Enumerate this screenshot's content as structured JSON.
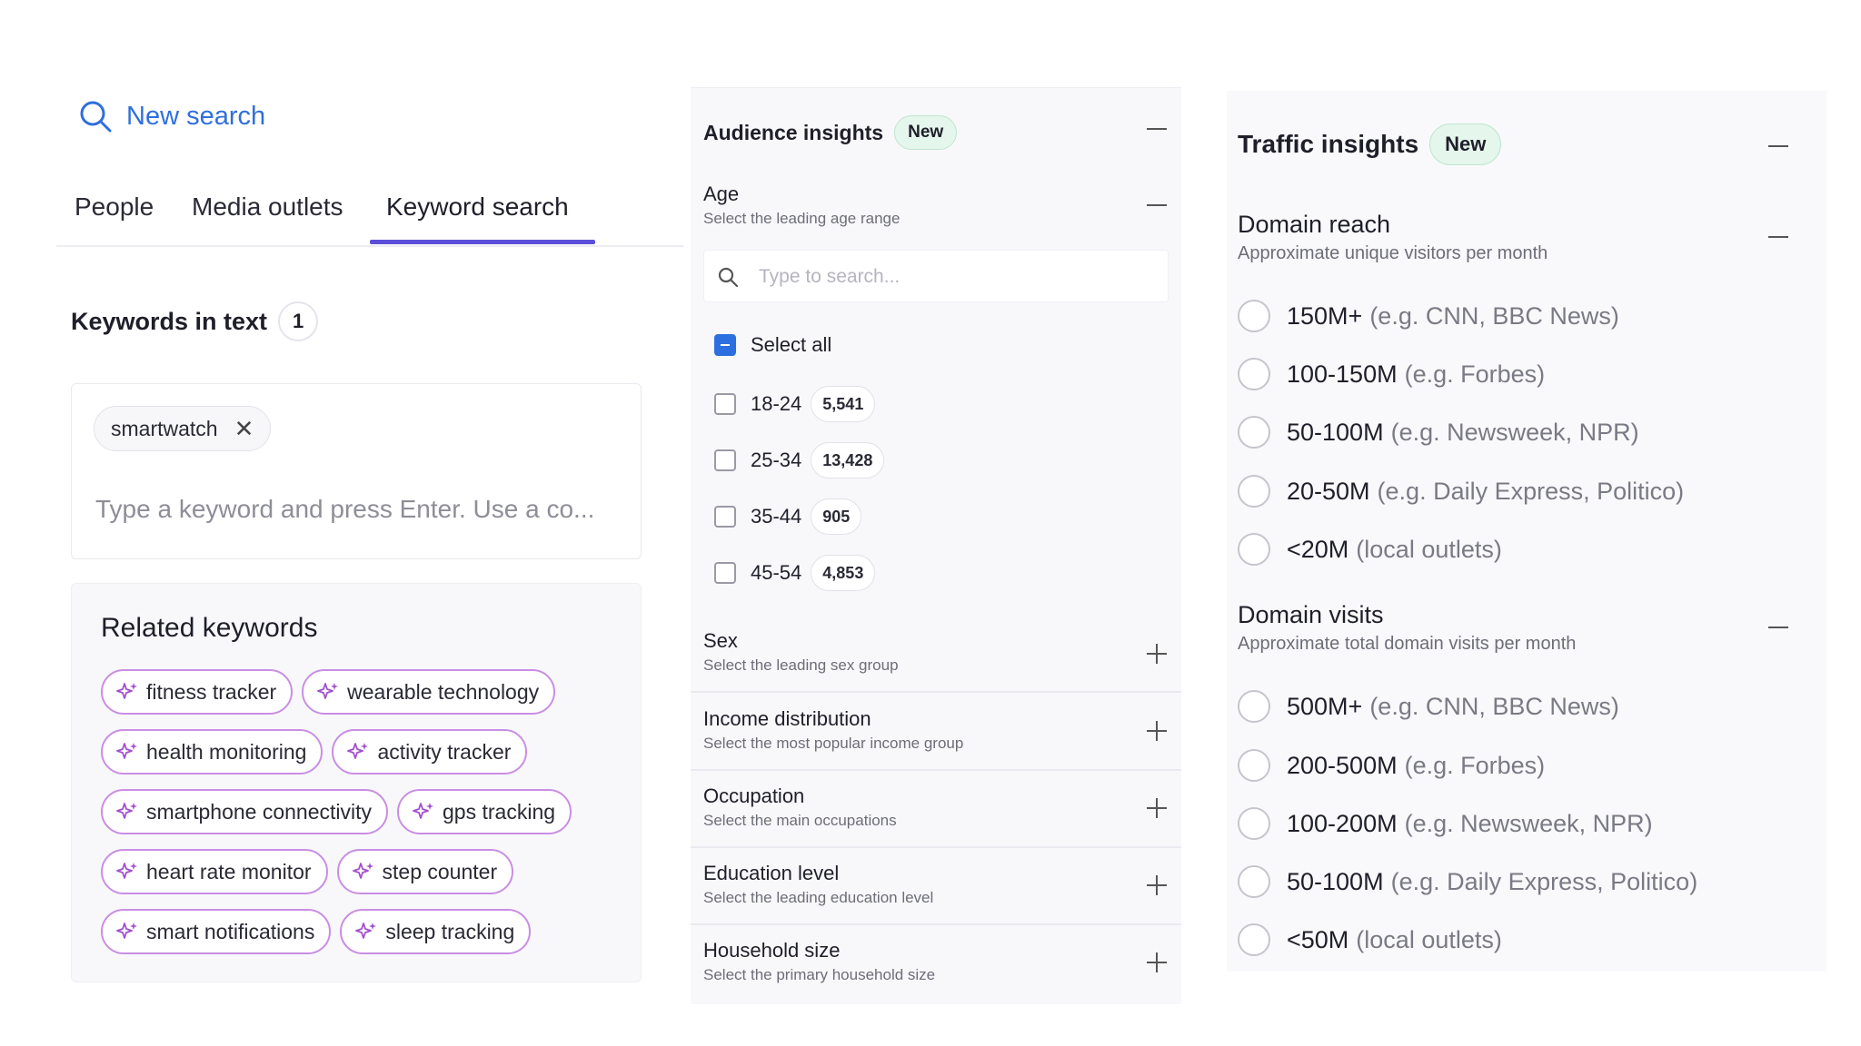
{
  "search": {
    "new_search_label": "New search",
    "tabs": [
      {
        "label": "People"
      },
      {
        "label": "Media outlets"
      },
      {
        "label": "Keyword search"
      }
    ],
    "active_tab": "Keyword search"
  },
  "keywords": {
    "title": "Keywords in text",
    "count": "1",
    "chips": [
      {
        "label": "smartwatch"
      }
    ],
    "input_placeholder": "Type a keyword and press Enter. Use a co..."
  },
  "related": {
    "title": "Related keywords",
    "items": [
      {
        "label": "fitness tracker"
      },
      {
        "label": "wearable technology"
      },
      {
        "label": "health monitoring"
      },
      {
        "label": "activity tracker"
      },
      {
        "label": "smartphone connectivity"
      },
      {
        "label": "gps tracking"
      },
      {
        "label": "heart rate monitor"
      },
      {
        "label": "step counter"
      },
      {
        "label": "smart notifications"
      },
      {
        "label": "sleep tracking"
      }
    ]
  },
  "audience": {
    "title": "Audience insights",
    "badge": "New",
    "age": {
      "title": "Age",
      "subtitle": "Select the leading age range",
      "search_placeholder": "Type to search...",
      "select_all": "Select all",
      "options": [
        {
          "label": "18-24",
          "count": "5,541"
        },
        {
          "label": "25-34",
          "count": "13,428"
        },
        {
          "label": "35-44",
          "count": "905"
        },
        {
          "label": "45-54",
          "count": "4,853"
        }
      ]
    },
    "sections": [
      {
        "title": "Sex",
        "subtitle": "Select the leading sex group"
      },
      {
        "title": "Income distribution",
        "subtitle": "Select the most popular income group"
      },
      {
        "title": "Occupation",
        "subtitle": "Select the main occupations"
      },
      {
        "title": "Education level",
        "subtitle": "Select the leading education level"
      },
      {
        "title": "Household size",
        "subtitle": "Select the primary household size"
      }
    ]
  },
  "traffic": {
    "title": "Traffic insights",
    "badge": "New",
    "domain_reach": {
      "title": "Domain reach",
      "subtitle": "Approximate unique visitors per month",
      "options": [
        {
          "label": "150M+",
          "example": "(e.g. CNN, BBC News)"
        },
        {
          "label": "100-150M",
          "example": "(e.g. Forbes)"
        },
        {
          "label": "50-100M",
          "example": "(e.g. Newsweek, NPR)"
        },
        {
          "label": "20-50M",
          "example": "(e.g. Daily Express, Politico)"
        },
        {
          "label": "<20M",
          "example": "(local outlets)"
        }
      ]
    },
    "domain_visits": {
      "title": "Domain visits",
      "subtitle": "Approximate total domain visits per month",
      "options": [
        {
          "label": "500M+",
          "example": "(e.g. CNN, BBC News)"
        },
        {
          "label": "200-500M",
          "example": "(e.g. Forbes)"
        },
        {
          "label": "100-200M",
          "example": "(e.g. Newsweek, NPR)"
        },
        {
          "label": "50-100M",
          "example": "(e.g. Daily Express, Politico)"
        },
        {
          "label": "<50M",
          "example": "(local outlets)"
        }
      ]
    }
  },
  "colors": {
    "accent_blue": "#2f6fdd",
    "tab_underline": "#5b4ed8",
    "pill_border": "#c98ee3",
    "new_badge_bg": "#e5f6ec"
  }
}
